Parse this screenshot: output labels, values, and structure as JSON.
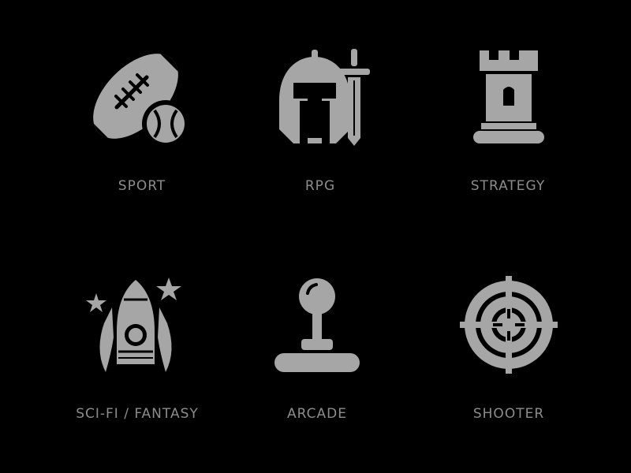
{
  "colors": {
    "background": "#000000",
    "icon": "#a6a6a6",
    "label": "#8c8c8c"
  },
  "categories": [
    {
      "icon": "american-football-with-baseball-icon",
      "label": "SPORT"
    },
    {
      "icon": "knight-helmet-with-sword-icon",
      "label": "RPG"
    },
    {
      "icon": "chess-rook-tower-icon",
      "label": "STRATEGY"
    },
    {
      "icon": "rocket-with-stars-icon",
      "label": "SCI-FI / FANTASY"
    },
    {
      "icon": "joystick-icon",
      "label": "ARCADE"
    },
    {
      "icon": "crosshair-target-icon",
      "label": "SHOOTER"
    }
  ]
}
